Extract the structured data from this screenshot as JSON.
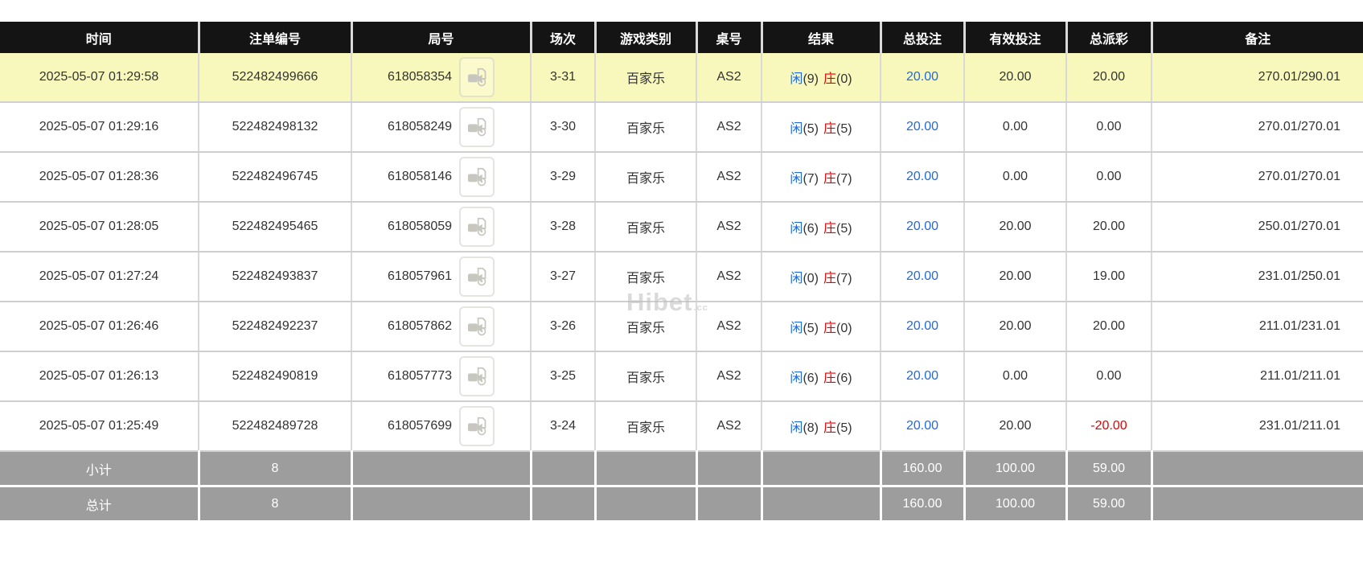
{
  "table": {
    "columns": [
      {
        "key": "time",
        "label": "时间"
      },
      {
        "key": "bet_id",
        "label": "注单编号"
      },
      {
        "key": "round",
        "label": "局号"
      },
      {
        "key": "session",
        "label": "场次"
      },
      {
        "key": "game",
        "label": "游戏类别"
      },
      {
        "key": "table_no",
        "label": "桌号"
      },
      {
        "key": "result",
        "label": "结果"
      },
      {
        "key": "total_bet",
        "label": "总投注"
      },
      {
        "key": "valid_bet",
        "label": "有效投注"
      },
      {
        "key": "payout",
        "label": "总派彩"
      },
      {
        "key": "remark",
        "label": "备注"
      }
    ],
    "rows": [
      {
        "time": "2025-05-07 01:29:58",
        "bet_id": "522482499666",
        "round": "618058354",
        "session": "3-31",
        "game": "百家乐",
        "table_no": "AS2",
        "result": {
          "player_label": "闲",
          "player_score": "(9)",
          "banker_label": "庄",
          "banker_score": "(0)"
        },
        "total_bet": "20.00",
        "valid_bet": "20.00",
        "payout": "20.00",
        "payout_red": false,
        "remark": "270.01/290.01",
        "highlight": true
      },
      {
        "time": "2025-05-07 01:29:16",
        "bet_id": "522482498132",
        "round": "618058249",
        "session": "3-30",
        "game": "百家乐",
        "table_no": "AS2",
        "result": {
          "player_label": "闲",
          "player_score": "(5)",
          "banker_label": "庄",
          "banker_score": "(5)"
        },
        "total_bet": "20.00",
        "valid_bet": "0.00",
        "payout": "0.00",
        "payout_red": false,
        "remark": "270.01/270.01",
        "highlight": false
      },
      {
        "time": "2025-05-07 01:28:36",
        "bet_id": "522482496745",
        "round": "618058146",
        "session": "3-29",
        "game": "百家乐",
        "table_no": "AS2",
        "result": {
          "player_label": "闲",
          "player_score": "(7)",
          "banker_label": "庄",
          "banker_score": "(7)"
        },
        "total_bet": "20.00",
        "valid_bet": "0.00",
        "payout": "0.00",
        "payout_red": false,
        "remark": "270.01/270.01",
        "highlight": false
      },
      {
        "time": "2025-05-07 01:28:05",
        "bet_id": "522482495465",
        "round": "618058059",
        "session": "3-28",
        "game": "百家乐",
        "table_no": "AS2",
        "result": {
          "player_label": "闲",
          "player_score": "(6)",
          "banker_label": "庄",
          "banker_score": "(5)"
        },
        "total_bet": "20.00",
        "valid_bet": "20.00",
        "payout": "20.00",
        "payout_red": false,
        "remark": "250.01/270.01",
        "highlight": false
      },
      {
        "time": "2025-05-07 01:27:24",
        "bet_id": "522482493837",
        "round": "618057961",
        "session": "3-27",
        "game": "百家乐",
        "table_no": "AS2",
        "result": {
          "player_label": "闲",
          "player_score": "(0)",
          "banker_label": "庄",
          "banker_score": "(7)"
        },
        "total_bet": "20.00",
        "valid_bet": "20.00",
        "payout": "19.00",
        "payout_red": false,
        "remark": "231.01/250.01",
        "highlight": false
      },
      {
        "time": "2025-05-07 01:26:46",
        "bet_id": "522482492237",
        "round": "618057862",
        "session": "3-26",
        "game": "百家乐",
        "table_no": "AS2",
        "result": {
          "player_label": "闲",
          "player_score": "(5)",
          "banker_label": "庄",
          "banker_score": "(0)"
        },
        "total_bet": "20.00",
        "valid_bet": "20.00",
        "payout": "20.00",
        "payout_red": false,
        "remark": "211.01/231.01",
        "highlight": false
      },
      {
        "time": "2025-05-07 01:26:13",
        "bet_id": "522482490819",
        "round": "618057773",
        "session": "3-25",
        "game": "百家乐",
        "table_no": "AS2",
        "result": {
          "player_label": "闲",
          "player_score": "(6)",
          "banker_label": "庄",
          "banker_score": "(6)"
        },
        "total_bet": "20.00",
        "valid_bet": "0.00",
        "payout": "0.00",
        "payout_red": false,
        "remark": "211.01/211.01",
        "highlight": false
      },
      {
        "time": "2025-05-07 01:25:49",
        "bet_id": "522482489728",
        "round": "618057699",
        "session": "3-24",
        "game": "百家乐",
        "table_no": "AS2",
        "result": {
          "player_label": "闲",
          "player_score": "(8)",
          "banker_label": "庄",
          "banker_score": "(5)"
        },
        "total_bet": "20.00",
        "valid_bet": "20.00",
        "payout": "-20.00",
        "payout_red": true,
        "remark": "231.01/211.01",
        "highlight": false
      }
    ],
    "footer": [
      {
        "label": "小计",
        "count": "8",
        "total_bet": "160.00",
        "valid_bet": "100.00",
        "payout": "59.00"
      },
      {
        "label": "总计",
        "count": "8",
        "total_bet": "160.00",
        "valid_bet": "100.00",
        "payout": "59.00"
      }
    ]
  },
  "watermark": {
    "text": "Hibet",
    "suffix": ".cc"
  },
  "colors": {
    "header_bg": "#141414",
    "highlight_row": "#f8f8bc",
    "footer_bg": "#9d9d9d",
    "player_blue": "#2069e0",
    "banker_red": "#e60000",
    "bet_blue": "#2069e0",
    "negative_red": "#e60000"
  }
}
